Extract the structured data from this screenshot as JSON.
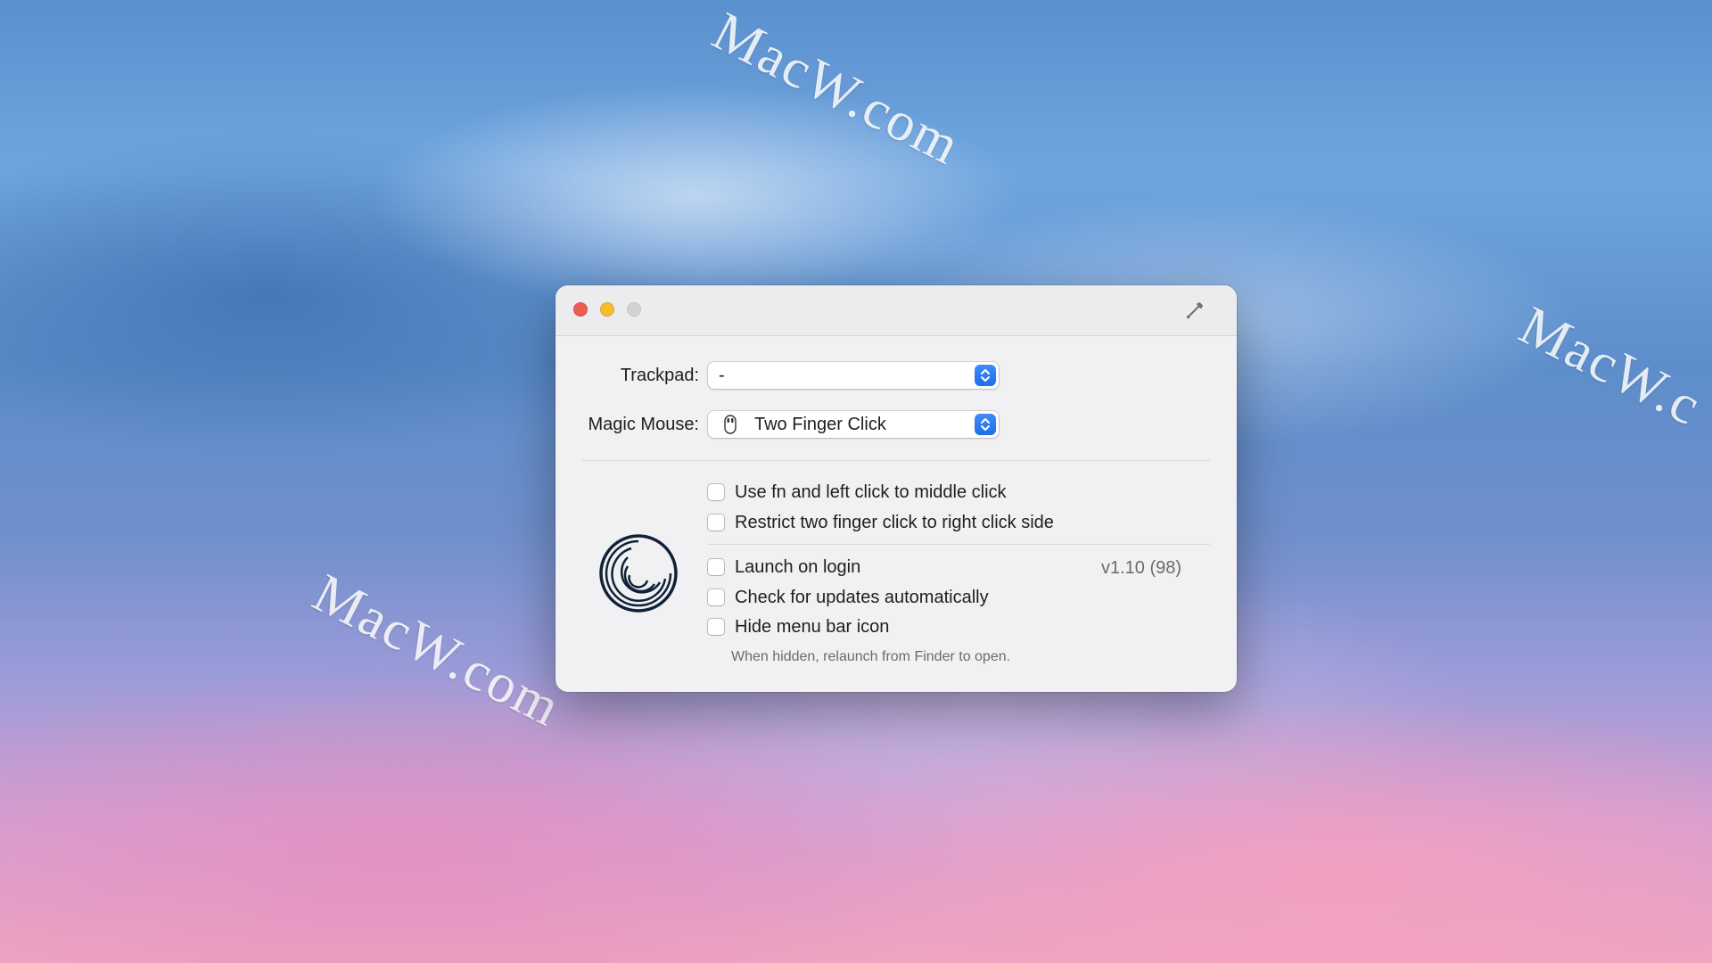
{
  "watermark": {
    "text": "MacW.com",
    "text_right": "MacW.c"
  },
  "window": {
    "trackpad": {
      "label": "Trackpad:",
      "value": "-"
    },
    "magic_mouse": {
      "label": "Magic Mouse:",
      "value": "Two Finger Click"
    },
    "options": [
      {
        "label": "Use fn and left click to middle click",
        "checked": false
      },
      {
        "label": "Restrict two finger click to right click side",
        "checked": false
      }
    ],
    "general": [
      {
        "label": "Launch on login",
        "checked": false
      },
      {
        "label": "Check for updates automatically",
        "checked": false
      },
      {
        "label": "Hide menu bar icon",
        "checked": false
      }
    ],
    "version": "v1.10 (98)",
    "hide_note": "When hidden, relaunch from Finder to open.",
    "colors": {
      "accent": "#2a7bf0",
      "close": "#ee5c56",
      "minimize": "#f6bd2f",
      "zoom_disabled": "#d3d3d6"
    },
    "icons": {
      "tool": "wrench-icon",
      "app_logo": "spiral-logo-icon",
      "mouse": "magic-mouse-icon"
    }
  }
}
